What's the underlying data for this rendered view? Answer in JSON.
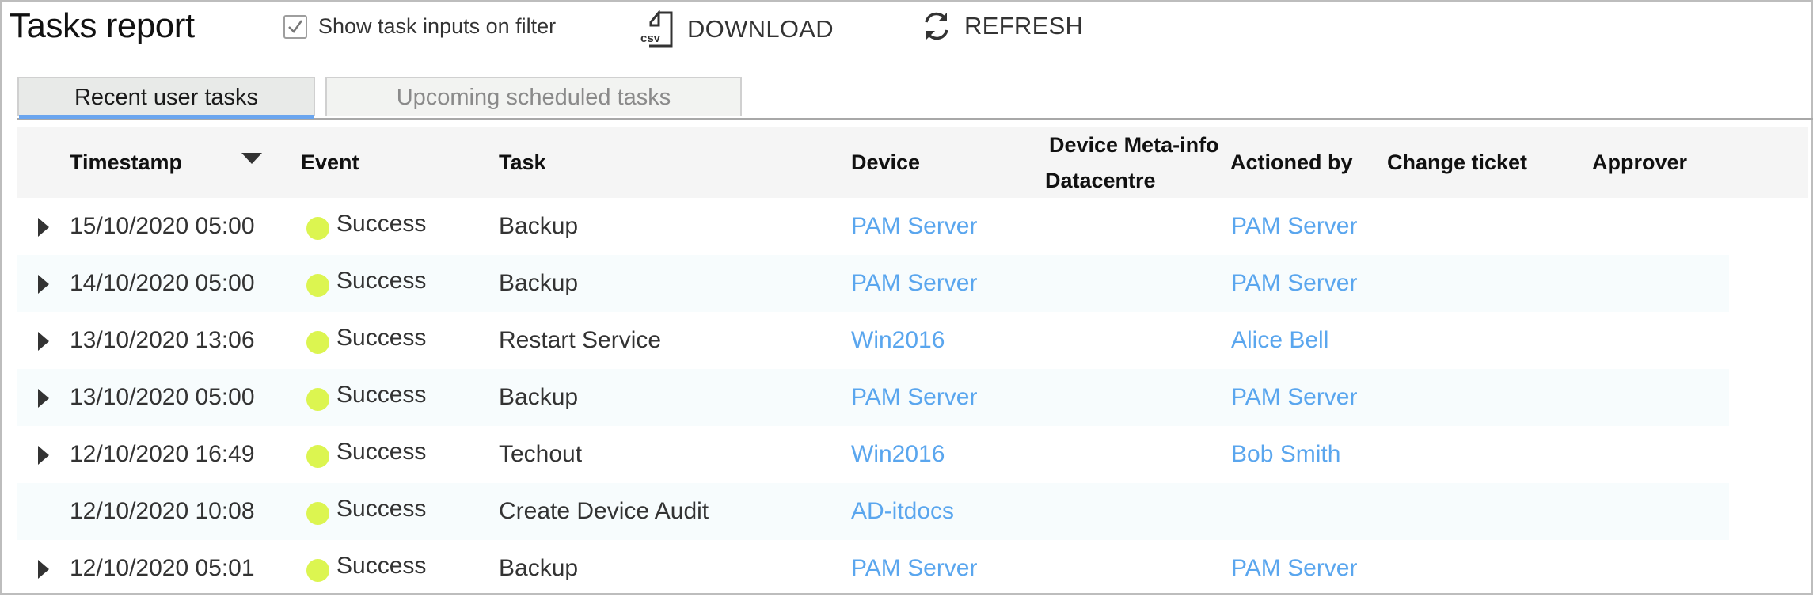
{
  "header": {
    "title": "Tasks report",
    "show_inputs_checkbox": {
      "label": "Show task inputs on filter",
      "checked": true
    },
    "download": {
      "label": "DOWNLOAD",
      "icon": "csv-file-icon"
    },
    "refresh": {
      "label": "REFRESH",
      "icon": "refresh-icon"
    }
  },
  "tabs": [
    {
      "label": "Recent user tasks",
      "active": true
    },
    {
      "label": "Upcoming scheduled tasks",
      "active": false
    }
  ],
  "table": {
    "columns": {
      "timestamp": "Timestamp",
      "event": "Event",
      "task": "Task",
      "device": "Device",
      "device_meta_line1": "Device Meta-info",
      "device_meta_line2": "Datacentre",
      "actioned_by": "Actioned by",
      "change_ticket": "Change ticket",
      "approver": "Approver"
    },
    "sort": {
      "column": "timestamp",
      "direction": "descending"
    },
    "status_color": "#dcf550",
    "link_color": "#5aa6ee",
    "rows": [
      {
        "expandable": true,
        "timestamp": "15/10/2020 05:00",
        "event": "Success",
        "task": "Backup",
        "device": "PAM Server",
        "datacentre": "",
        "actioned_by": "PAM Server",
        "change_ticket": "",
        "approver": ""
      },
      {
        "expandable": true,
        "timestamp": "14/10/2020 05:00",
        "event": "Success",
        "task": "Backup",
        "device": "PAM Server",
        "datacentre": "",
        "actioned_by": "PAM Server",
        "change_ticket": "",
        "approver": ""
      },
      {
        "expandable": true,
        "timestamp": "13/10/2020 13:06",
        "event": "Success",
        "task": "Restart Service",
        "device": "Win2016",
        "datacentre": "",
        "actioned_by": "Alice Bell",
        "change_ticket": "",
        "approver": ""
      },
      {
        "expandable": true,
        "timestamp": "13/10/2020 05:00",
        "event": "Success",
        "task": "Backup",
        "device": "PAM Server",
        "datacentre": "",
        "actioned_by": "PAM Server",
        "change_ticket": "",
        "approver": ""
      },
      {
        "expandable": true,
        "timestamp": "12/10/2020 16:49",
        "event": "Success",
        "task": "Techout",
        "device": "Win2016",
        "datacentre": "",
        "actioned_by": "Bob Smith",
        "change_ticket": "",
        "approver": ""
      },
      {
        "expandable": false,
        "timestamp": "12/10/2020 10:08",
        "event": "Success",
        "task": "Create Device Audit",
        "device": "AD-itdocs",
        "datacentre": "",
        "actioned_by": "",
        "change_ticket": "",
        "approver": ""
      },
      {
        "expandable": true,
        "timestamp": "12/10/2020 05:01",
        "event": "Success",
        "task": "Backup",
        "device": "PAM Server",
        "datacentre": "",
        "actioned_by": "PAM Server",
        "change_ticket": "",
        "approver": ""
      }
    ]
  }
}
